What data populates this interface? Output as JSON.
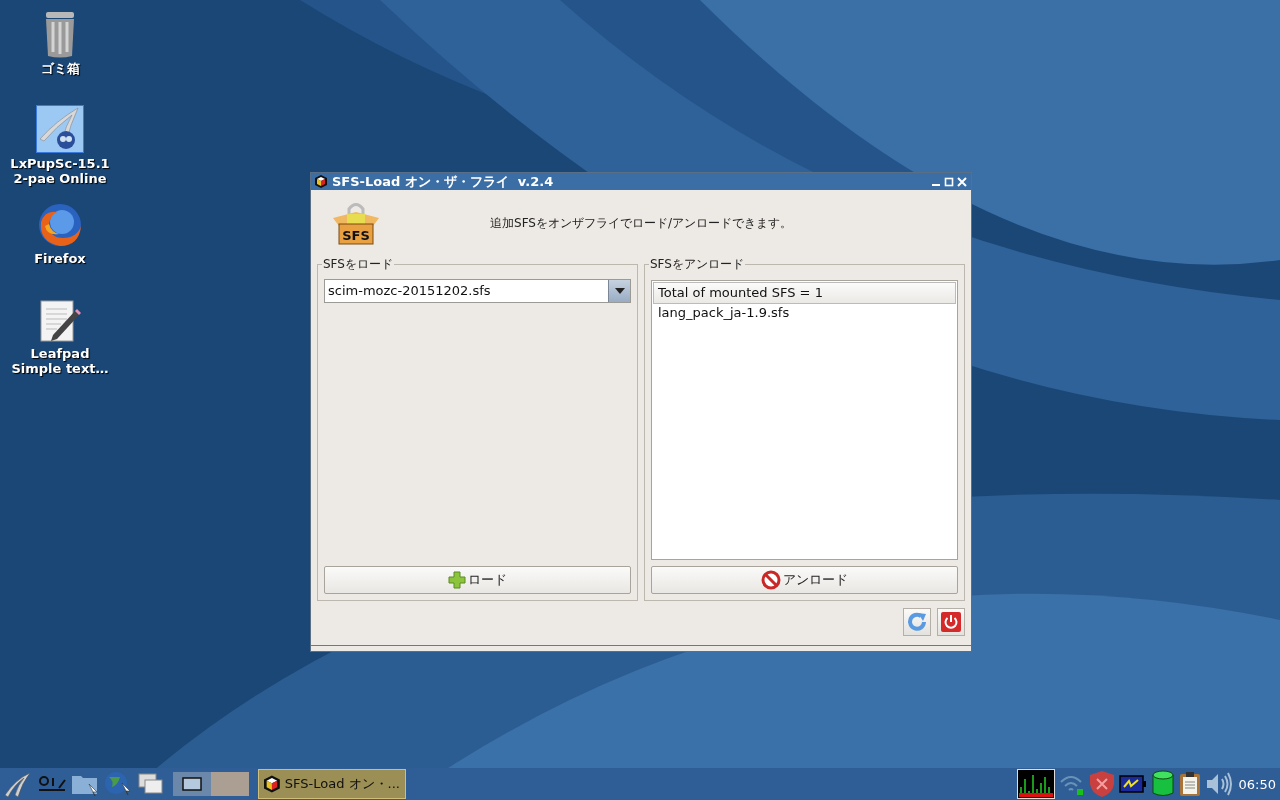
{
  "desktop_icons": [
    {
      "kind": "trash",
      "lines": [
        "ゴミ箱"
      ]
    },
    {
      "kind": "lxpup",
      "lines": [
        "LxPupSc-15.1",
        "2-pae Online"
      ]
    },
    {
      "kind": "firefox",
      "lines": [
        "Firefox"
      ]
    },
    {
      "kind": "leafpad",
      "lines": [
        "Leafpad",
        "Simple text…"
      ]
    }
  ],
  "window": {
    "title": "SFS-Load オン・ザ・フライ  v.2.4",
    "icon_label": "SFS",
    "description": "追加SFSをオンザフライでロード/アンロードできます。",
    "load_panel": {
      "legend": "SFSをロード",
      "combo_value": "scim-mozc-20151202.sfs",
      "button": "ロード"
    },
    "unload_panel": {
      "legend": "SFSをアンロード",
      "items": [
        {
          "kind": "header",
          "text": "Total of mounted SFS = 1"
        },
        {
          "kind": "item",
          "text": "lang_pack_ja-1.9.sfs"
        }
      ],
      "button": "アンロード"
    }
  },
  "taskbar": {
    "pager": [
      {
        "selected": true
      },
      {
        "selected": false
      }
    ],
    "task": "SFS-Load オン・...",
    "clock": "06:50"
  }
}
